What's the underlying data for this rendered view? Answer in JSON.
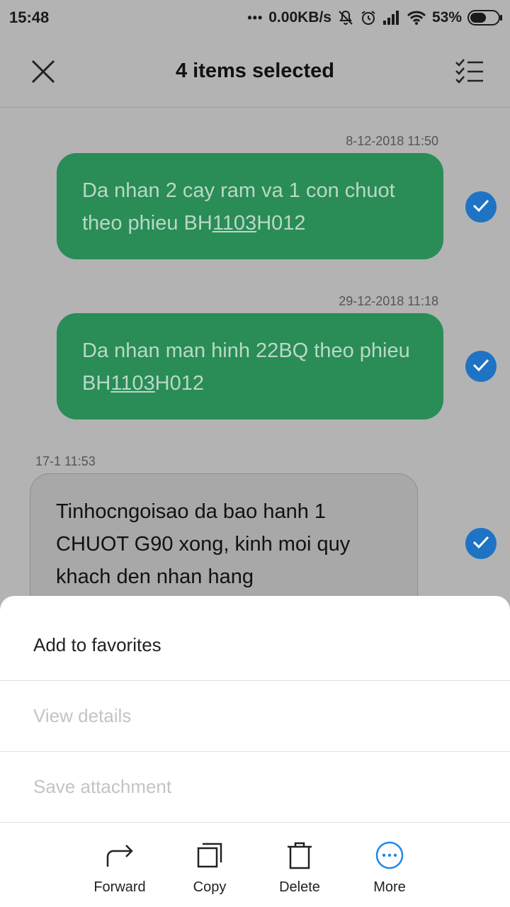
{
  "status_bar": {
    "time": "15:48",
    "dots": "•••",
    "net_speed": "0.00KB/s",
    "battery": "53%"
  },
  "header": {
    "title": "4 items selected"
  },
  "messages": [
    {
      "timestamp": "8-12-2018 11:50",
      "text_before": "Da nhan 2 cay ram va 1 con chuot theo phieu BH",
      "text_link": "1103",
      "text_after": "H012",
      "direction": "outgoing",
      "selected": true
    },
    {
      "timestamp": "29-12-2018 11:18",
      "text_before": "Da nhan man hinh 22BQ theo phieu BH",
      "text_link": "1103",
      "text_after": "H012",
      "direction": "outgoing",
      "selected": true
    },
    {
      "timestamp": "17-1 11:53",
      "text": "Tinhocngoisao da bao hanh 1 CHUOT G90 xong, kinh moi quy khach den nhan hang",
      "direction": "incoming",
      "selected": true
    }
  ],
  "sheet": {
    "items": [
      {
        "label": "Add to favorites",
        "enabled": true
      },
      {
        "label": "View details",
        "enabled": false
      },
      {
        "label": "Save attachment",
        "enabled": false
      }
    ],
    "toolbar": [
      {
        "label": "Forward",
        "icon": "forward-icon"
      },
      {
        "label": "Copy",
        "icon": "copy-icon"
      },
      {
        "label": "Delete",
        "icon": "delete-icon"
      },
      {
        "label": "More",
        "icon": "more-icon"
      }
    ]
  },
  "colors": {
    "outgoing_bubble": "#2a8c57",
    "check_accent": "#1f73c4",
    "more_accent": "#1e88e5"
  }
}
